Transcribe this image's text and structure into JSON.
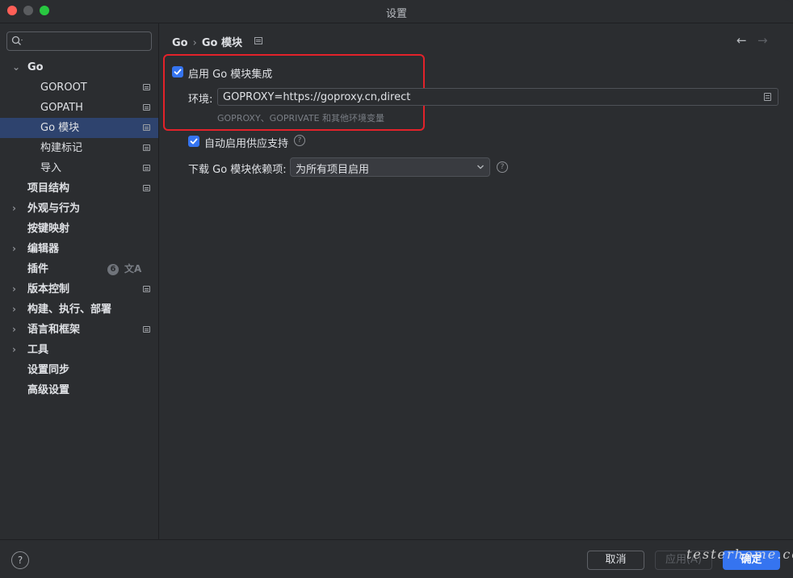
{
  "window": {
    "title": "设置"
  },
  "sidebar": {
    "search_placeholder": "",
    "items": [
      {
        "label": "Go"
      },
      {
        "label": "GOROOT"
      },
      {
        "label": "GOPATH"
      },
      {
        "label": "Go 模块"
      },
      {
        "label": "构建标记"
      },
      {
        "label": "导入"
      },
      {
        "label": "项目结构"
      },
      {
        "label": "外观与行为"
      },
      {
        "label": "按键映射"
      },
      {
        "label": "编辑器"
      },
      {
        "label": "插件",
        "badge": "6"
      },
      {
        "label": "版本控制"
      },
      {
        "label": "构建、执行、部署"
      },
      {
        "label": "语言和框架"
      },
      {
        "label": "工具"
      },
      {
        "label": "设置同步"
      },
      {
        "label": "高级设置"
      }
    ]
  },
  "breadcrumb": {
    "parent": "Go",
    "separator": "›",
    "current": "Go 模块"
  },
  "navigation": {
    "back": "←",
    "forward": "→"
  },
  "go_modules": {
    "enable_label": "启用 Go 模块集成",
    "enable_checked": true,
    "env_label": "环境:",
    "env_value": "GOPROXY=https://goproxy.cn,direct",
    "env_hint": "GOPROXY、GOPRIVATE 和其他环境变量",
    "vendoring_label": "自动启用供应支持",
    "vendoring_checked": true,
    "download_label": "下载 Go 模块依赖项:",
    "download_value": "为所有项目启用",
    "help_glyph": "?"
  },
  "footer": {
    "help_glyph": "?",
    "cancel_label": "取消",
    "apply_label": "应用(A)",
    "ok_label": "确定"
  },
  "watermark": "testerhome.com",
  "colors": {
    "accent": "#3574f0",
    "selection": "#2e436e",
    "highlight_border": "#e3222a",
    "background": "#2b2d30"
  }
}
